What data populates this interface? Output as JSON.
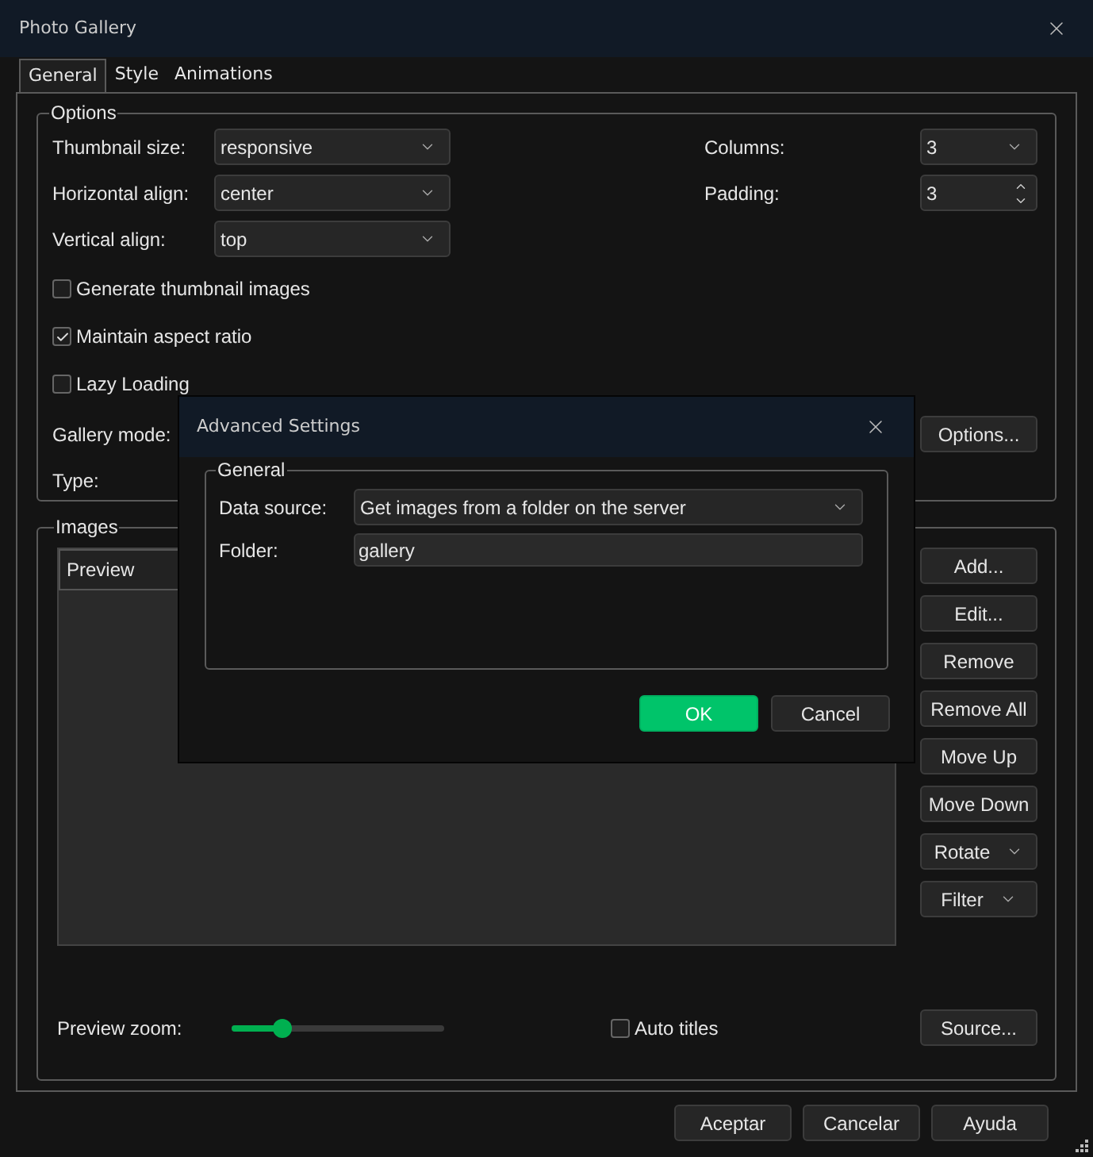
{
  "window": {
    "title": "Photo Gallery"
  },
  "tabs": [
    {
      "label": "General",
      "selected": true
    },
    {
      "label": "Style",
      "selected": false
    },
    {
      "label": "Animations",
      "selected": false
    }
  ],
  "options": {
    "title": "Options",
    "fields": [
      {
        "label": "Thumbnail size:",
        "value": "responsive",
        "kind": "select"
      },
      {
        "label": "Horizontal align:",
        "value": "center",
        "kind": "select"
      },
      {
        "label": "Vertical align:",
        "value": "top",
        "kind": "select"
      }
    ],
    "right_fields": [
      {
        "label": "Columns:",
        "value": "3",
        "kind": "select"
      },
      {
        "label": "Padding:",
        "value": "3",
        "kind": "spinner"
      }
    ],
    "checkboxes": [
      {
        "label": "Generate thumbnail images",
        "checked": false
      },
      {
        "label": "Maintain aspect ratio",
        "checked": true
      },
      {
        "label": "Lazy Loading",
        "checked": false
      }
    ],
    "gallery_mode": {
      "label": "Gallery mode:",
      "button": "Options..."
    },
    "type": {
      "label": "Type:"
    }
  },
  "images": {
    "title": "Images",
    "list_header": "Preview",
    "buttons": [
      {
        "label": "Add...",
        "kind": "plain"
      },
      {
        "label": "Edit...",
        "kind": "plain"
      },
      {
        "label": "Remove",
        "kind": "plain"
      },
      {
        "label": "Remove All",
        "kind": "plain"
      },
      {
        "label": "Move Up",
        "kind": "plain"
      },
      {
        "label": "Move Down",
        "kind": "plain"
      },
      {
        "label": "Rotate",
        "kind": "menu"
      },
      {
        "label": "Filter",
        "kind": "menu"
      }
    ],
    "preview_zoom": {
      "label": "Preview zoom:",
      "level": 0.24
    },
    "auto_titles": {
      "label": "Auto titles",
      "checked": false
    },
    "source_button": "Source..."
  },
  "dialog_buttons": [
    "Aceptar",
    "Cancelar",
    "Ayuda"
  ],
  "advanced": {
    "title": "Advanced Settings",
    "group": "General",
    "fields": [
      {
        "label": "Data source:",
        "value": "Get images from a folder on the server",
        "kind": "select"
      },
      {
        "label": "Folder:",
        "value": "gallery",
        "kind": "text"
      }
    ],
    "buttons": [
      {
        "label": "OK",
        "kind": "primary"
      },
      {
        "label": "Cancel",
        "kind": "secondary"
      }
    ]
  }
}
